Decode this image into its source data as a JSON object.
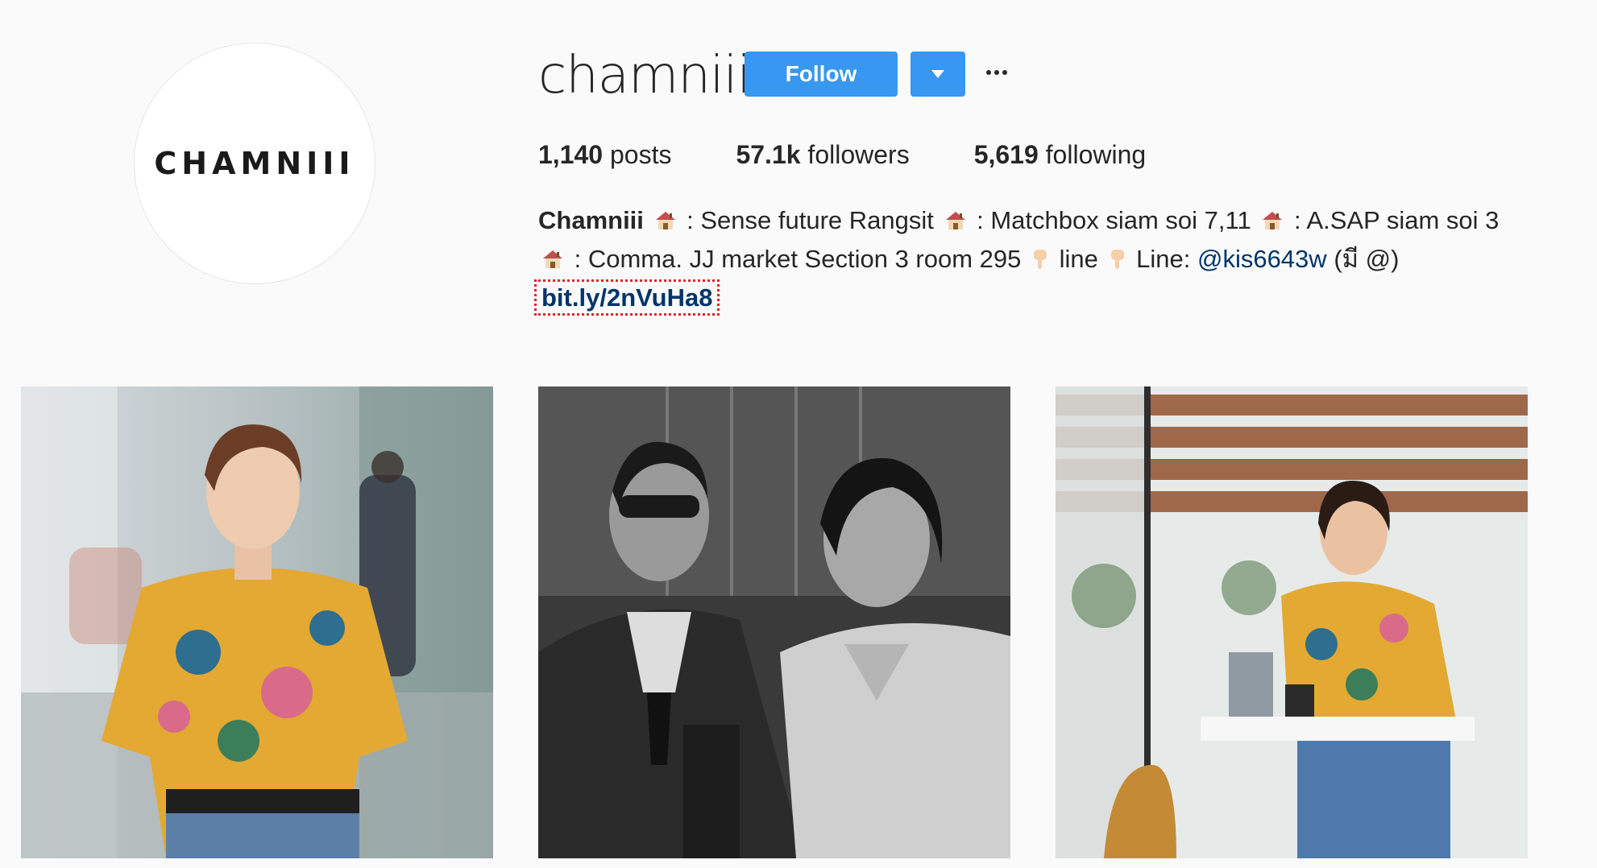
{
  "profile": {
    "avatar_text": "CHAMNIII",
    "username": "chamniii",
    "follow_label": "Follow"
  },
  "stats": {
    "posts_count": "1,140",
    "posts_label": "posts",
    "followers_count": "57.1k",
    "followers_label": "followers",
    "following_count": "5,619",
    "following_label": "following"
  },
  "bio": {
    "name": "Chamniii",
    "seg1": " : Sense future Rangsit ",
    "seg2": " : Matchbox siam soi 7,11 ",
    "seg3": " : A.SAP siam soi 3 ",
    "seg4": " : Comma. JJ market Section 3 room 295 ",
    "seg5": " line ",
    "seg6": " Line: ",
    "mention": "@kis6643w",
    "seg7": " (มี @) ",
    "link": "bit.ly/2nVuHa8"
  },
  "icons": {
    "house": "house-icon",
    "hand": "pointing-down-hand-icon",
    "more": "more-options-icon",
    "dropdown": "chevron-down-icon"
  },
  "colors": {
    "accent": "#3897f0",
    "link": "#003569",
    "background": "#fafafa",
    "highlight_outline": "#e0242b"
  }
}
